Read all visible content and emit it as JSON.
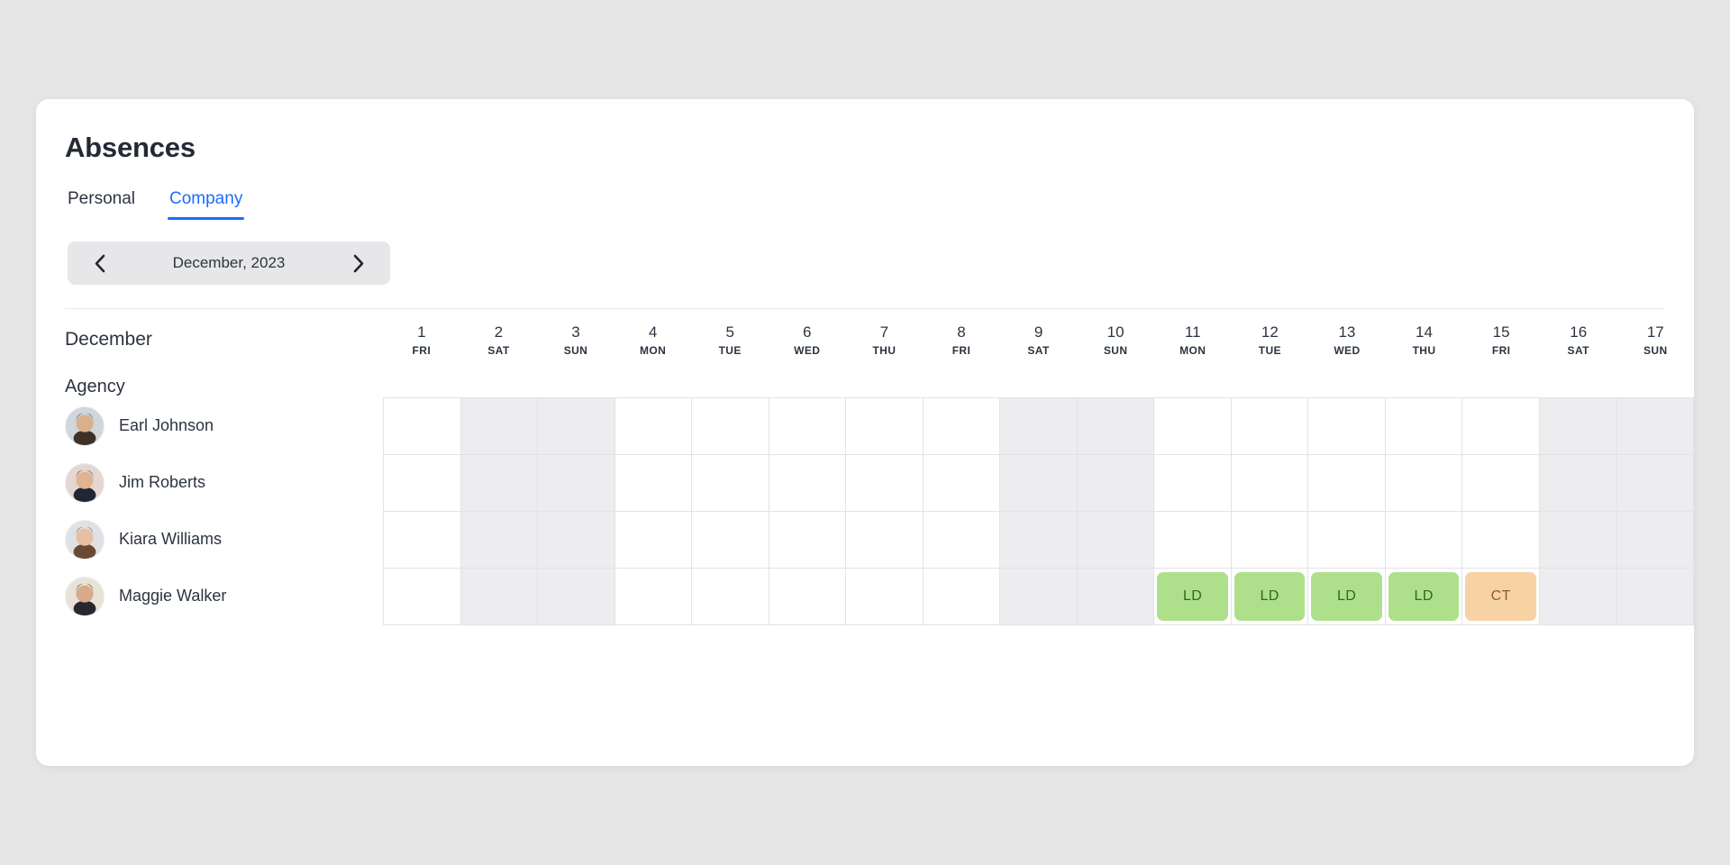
{
  "page": {
    "title": "Absences",
    "background_color": "#e6e6e6"
  },
  "tabs": [
    {
      "label": "Personal",
      "active": false
    },
    {
      "label": "Company",
      "active": true
    }
  ],
  "month_nav": {
    "prev_icon": "chevron-left-icon",
    "next_icon": "chevron-right-icon",
    "label": "December, 2023"
  },
  "calendar": {
    "month_label": "December",
    "group_label": "Agency",
    "days": [
      {
        "num": "1",
        "name": "FRI",
        "weekend": false
      },
      {
        "num": "2",
        "name": "SAT",
        "weekend": true
      },
      {
        "num": "3",
        "name": "SUN",
        "weekend": true
      },
      {
        "num": "4",
        "name": "MON",
        "weekend": false
      },
      {
        "num": "5",
        "name": "TUE",
        "weekend": false
      },
      {
        "num": "6",
        "name": "WED",
        "weekend": false
      },
      {
        "num": "7",
        "name": "THU",
        "weekend": false
      },
      {
        "num": "8",
        "name": "FRI",
        "weekend": false
      },
      {
        "num": "9",
        "name": "SAT",
        "weekend": true
      },
      {
        "num": "10",
        "name": "SUN",
        "weekend": true
      },
      {
        "num": "11",
        "name": "MON",
        "weekend": false
      },
      {
        "num": "12",
        "name": "TUE",
        "weekend": false
      },
      {
        "num": "13",
        "name": "WED",
        "weekend": false
      },
      {
        "num": "14",
        "name": "THU",
        "weekend": false
      },
      {
        "num": "15",
        "name": "FRI",
        "weekend": false
      },
      {
        "num": "16",
        "name": "SAT",
        "weekend": true
      },
      {
        "num": "17",
        "name": "SUN",
        "weekend": true
      }
    ],
    "people": [
      {
        "name": "Earl Johnson",
        "avatar": "avatar-earl-johnson",
        "absences": {}
      },
      {
        "name": "Jim Roberts",
        "avatar": "avatar-jim-roberts",
        "absences": {}
      },
      {
        "name": "Kiara Williams",
        "avatar": "avatar-kiara-williams",
        "absences": {}
      },
      {
        "name": "Maggie Walker",
        "avatar": "avatar-maggie-walker",
        "absences": {
          "11": {
            "code": "LD",
            "type": "ld"
          },
          "12": {
            "code": "LD",
            "type": "ld"
          },
          "13": {
            "code": "LD",
            "type": "ld"
          },
          "14": {
            "code": "LD",
            "type": "ld"
          },
          "15": {
            "code": "CT",
            "type": "ct"
          }
        }
      }
    ]
  },
  "colors": {
    "accent": "#1a6dff",
    "ld_badge_bg": "#aee08b",
    "ld_badge_text": "#2e6b18",
    "ct_badge_bg": "#f7d2a5",
    "ct_badge_text": "#9a5a1e",
    "weekend_cell": "#ededf0",
    "grid_line": "#e2e3e5"
  }
}
